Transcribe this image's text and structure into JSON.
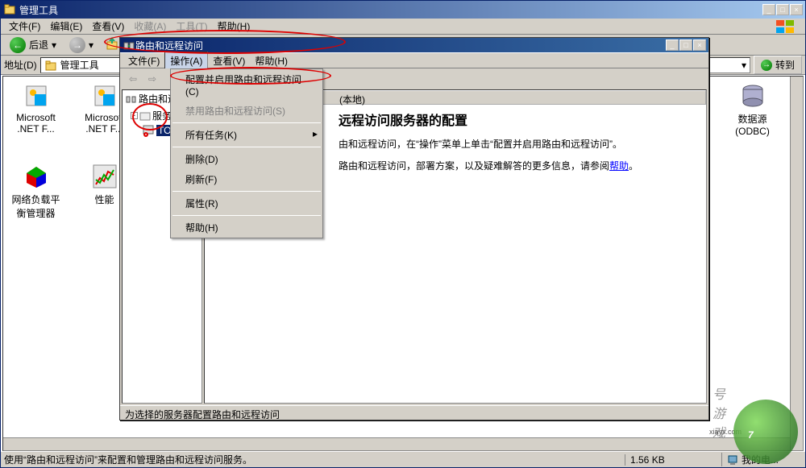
{
  "outer": {
    "title": "管理工具",
    "menu": {
      "file": "文件(F)",
      "edit": "编辑(E)",
      "view": "查看(V)",
      "favorites": "收藏(A)",
      "tools": "工具(T)",
      "help": "帮助(H)"
    },
    "toolbar": {
      "back": "后退"
    },
    "addr": {
      "label": "地址(D)",
      "value": "管理工具",
      "go": "转到"
    },
    "icons": [
      {
        "label": "Microsoft .NET F..."
      },
      {
        "label": "Microsoft .NET F..."
      },
      {
        "label": "网络负载平衡管理器"
      },
      {
        "label": "性能"
      },
      {
        "label": "数据源 (ODBC)"
      }
    ],
    "status": {
      "text": "使用“路由和远程访问”来配置和管理路由和远程访问服务。",
      "size": "1.56 KB",
      "computer": "我的电..."
    }
  },
  "inner": {
    "title": "路由和远程访问",
    "menu": {
      "file": "文件(F)",
      "action": "操作(A)",
      "view": "查看(V)",
      "help": "帮助(H)"
    },
    "tree": {
      "root": "路由和远程",
      "services": "服务",
      "server": "TOM"
    },
    "context": {
      "configure": "配置并启用路由和远程访问(C)",
      "disable": "禁用路由和远程访问(S)",
      "all_tasks": "所有任务(K)",
      "delete": "删除(D)",
      "refresh": "刷新(F)",
      "properties": "属性(R)",
      "help": "帮助(H)"
    },
    "content": {
      "header_text": "(本地)",
      "heading": "远程访问服务器的配置",
      "p1_prefix": "由和远程访问，在“操作”菜单上单击“配置并启用路由和远程访问”。",
      "p2_prefix": "路由和远程访问，部署方案，以及疑难解答的更多信息，请参阅",
      "help_link": "帮助",
      "p2_suffix": "。"
    },
    "status": "为选择的服务器配置路由和远程访问"
  },
  "watermark": {
    "text": "号游戏",
    "url": "xiayx.com"
  }
}
